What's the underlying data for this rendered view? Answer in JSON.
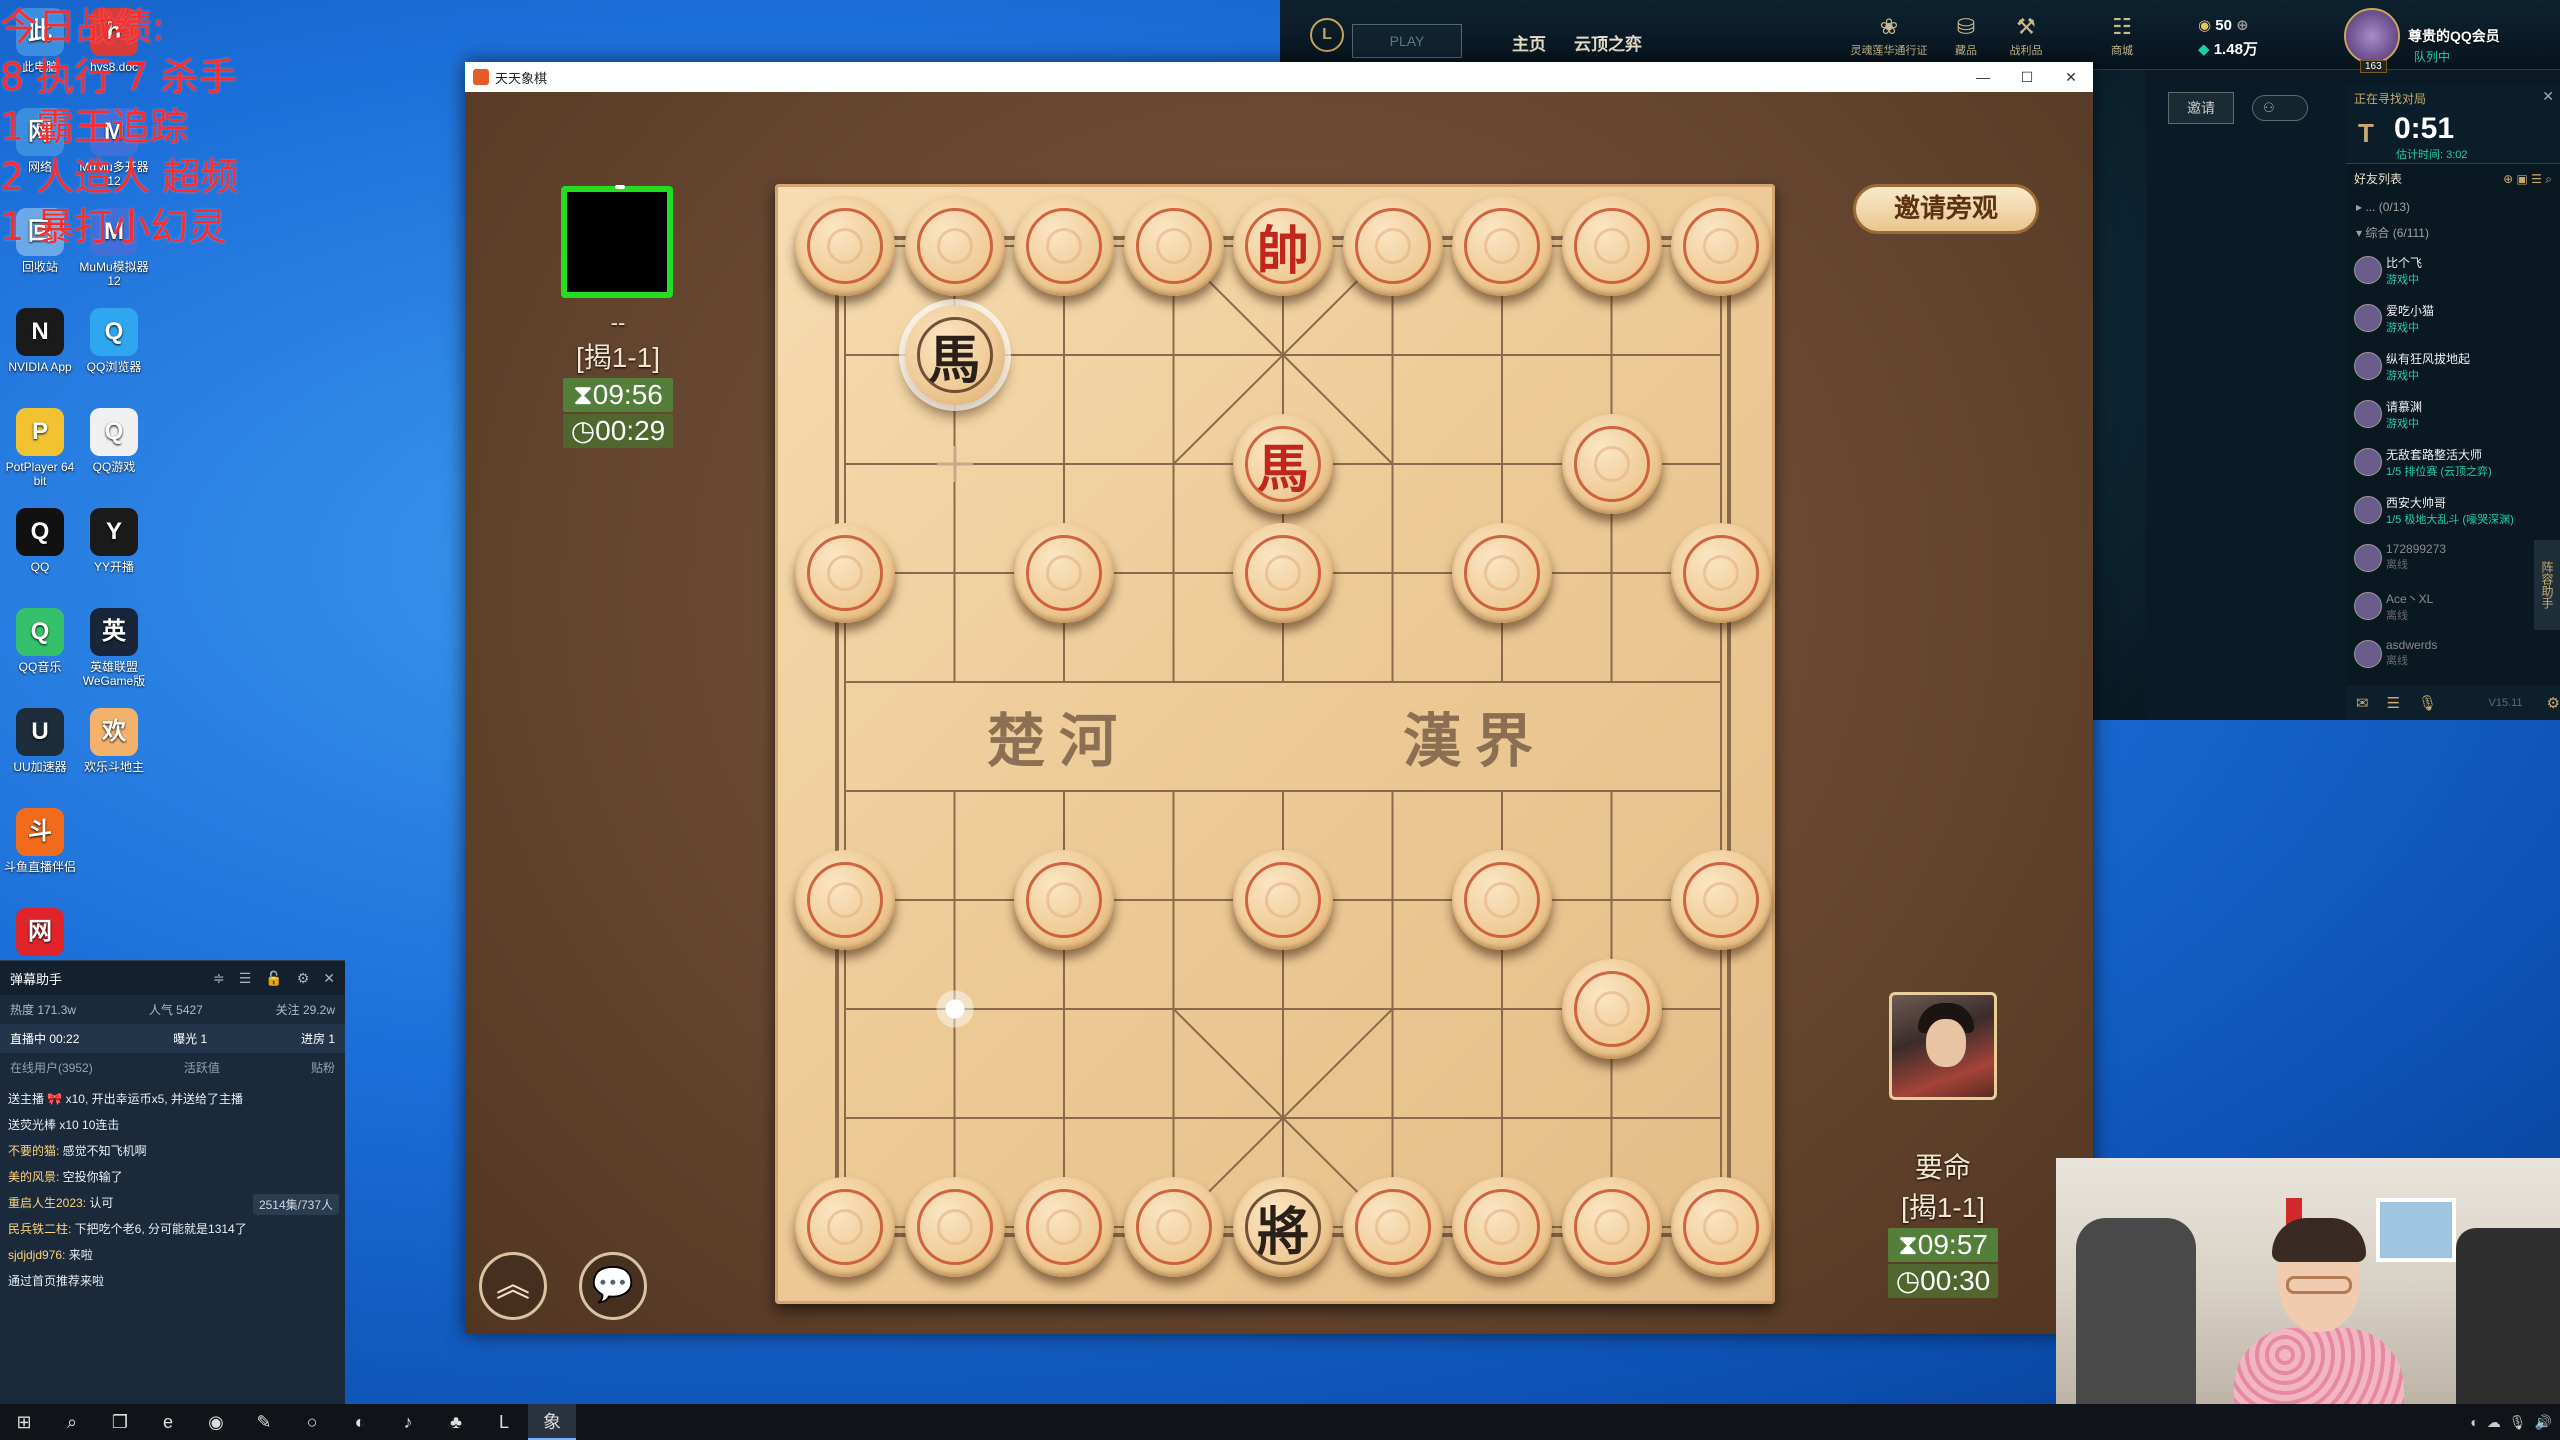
{
  "desktop": {
    "overlay_lines": [
      "今日战绩:",
      "8 执行 7 杀手",
      "1 霸王追踪",
      "2 人造人 超频",
      "1 暴打小幻灵"
    ],
    "icons": [
      {
        "label": "此电脑",
        "icon": "computer-icon",
        "color": "#3b8de0"
      },
      {
        "label": "hys8.doc",
        "icon": "document-icon",
        "color": "#d93b3b"
      },
      {
        "label": "网络",
        "icon": "network-icon",
        "color": "#3b8de0"
      },
      {
        "label": "MuMu多开器12",
        "icon": "mumu-icon",
        "color": "#3f6fd8"
      },
      {
        "label": "回收站",
        "icon": "recycle-bin-icon",
        "color": "#6aa8e8"
      },
      {
        "label": "MuMu模拟器12",
        "icon": "mumu-icon",
        "color": "#3f6fd8"
      },
      {
        "label": "NVIDIA App",
        "icon": "nvidia-icon",
        "color": "#1a1a1a"
      },
      {
        "label": "QQ浏览器",
        "icon": "qq-browser-icon",
        "color": "#2fa6f0"
      },
      {
        "label": "PotPlayer 64 bit",
        "icon": "potplayer-icon",
        "color": "#f1c232"
      },
      {
        "label": "QQ游戏",
        "icon": "qq-game-icon",
        "color": "#f0f0f0"
      },
      {
        "label": "QQ",
        "icon": "qq-penguin-icon",
        "color": "#111111"
      },
      {
        "label": "YY开播",
        "icon": "yy-icon",
        "color": "#1a1a1a"
      },
      {
        "label": "QQ音乐",
        "icon": "qq-music-icon",
        "color": "#35c16b"
      },
      {
        "label": "英雄联盟WeGame版",
        "icon": "lol-icon",
        "color": "#18253a"
      },
      {
        "label": "UU加速器",
        "icon": "uu-icon",
        "color": "#1d2c3a"
      },
      {
        "label": "欢乐斗地主",
        "icon": "doudizhu-icon",
        "color": "#f2b26b"
      },
      {
        "label": "斗鱼直播伴侣",
        "icon": "douyu-icon",
        "color": "#f26b1d"
      },
      {
        "label": "网易云音乐",
        "icon": "netease-music-icon",
        "color": "#e0242a"
      }
    ]
  },
  "danmu": {
    "title": "弹幕助手",
    "stats": [
      "热度 171.3w",
      "人气 5427",
      "关注 29.2w"
    ],
    "live_time": "直播中 00:22",
    "exposure": "曝光 1",
    "progress": "进房 1",
    "online": "在线用户(3952)",
    "tabs": [
      "活跃值",
      "贴粉"
    ],
    "messages": [
      {
        "user": "",
        "text": "送主播 🎀 x10, 开出幸运币x5, 并送给了主播"
      },
      {
        "user": "",
        "text": "送荧光棒 x10 10连击"
      },
      {
        "user": "不要的猫",
        "text": "感觉不知飞机啊"
      },
      {
        "user": "美的风景",
        "text": "空投你输了"
      },
      {
        "user": "重启人生2023",
        "text": "认可"
      },
      {
        "user": "民兵铁二柱",
        "text": "下把吃个老6, 分可能就是1314了"
      },
      {
        "user": "sjdjdjd976",
        "text": "来啦"
      },
      {
        "user": "",
        "text": "通过首页推荐来啦"
      }
    ],
    "count": "2514集/737人"
  },
  "taskbar": {
    "apps": [
      {
        "name": "start-icon",
        "glyph": "⊞"
      },
      {
        "name": "search-icon",
        "glyph": "⌕"
      },
      {
        "name": "task-view-icon",
        "glyph": "❐"
      },
      {
        "name": "edge-icon",
        "glyph": "e"
      },
      {
        "name": "netease-icon",
        "glyph": "◉"
      },
      {
        "name": "mouse-icon",
        "glyph": "✎"
      },
      {
        "name": "yy-icon",
        "glyph": "○"
      },
      {
        "name": "qq-browser-icon",
        "glyph": "◐"
      },
      {
        "name": "qq-music-icon",
        "glyph": "♪"
      },
      {
        "name": "doudizhu-icon",
        "glyph": "♣"
      },
      {
        "name": "lol-icon",
        "glyph": "L"
      },
      {
        "name": "xiangqi-icon",
        "glyph": "象"
      }
    ]
  },
  "lol": {
    "play_label": "PLAY",
    "nav": [
      "主页",
      "云顶之弈"
    ],
    "top_icons": [
      {
        "label": "灵魂莲华通行证",
        "icon": "lotus-icon"
      },
      {
        "label": "藏品",
        "icon": "collection-icon"
      },
      {
        "label": "战利品",
        "icon": "loot-icon"
      },
      {
        "label": "商城",
        "icon": "store-icon"
      }
    ],
    "currency": {
      "rp": "50",
      "be": "1.48万"
    },
    "profile": {
      "name": "尊贵的QQ会员",
      "status": "队列中",
      "level": "163"
    },
    "invite_label": "邀请",
    "queue": {
      "title": "正在寻找对局",
      "timer": "0:51",
      "estimate": "估计时间: 3:02"
    },
    "friends_title": "好友列表",
    "groups": [
      "... (0/13)",
      "综合 (6/111)"
    ],
    "friends": [
      {
        "name": "比个飞",
        "status": "游戏中",
        "online": true
      },
      {
        "name": "爱吃小猫",
        "status": "游戏中",
        "online": true
      },
      {
        "name": "纵有狂风拔地起",
        "status": "游戏中",
        "online": true
      },
      {
        "name": "请慕渊",
        "status": "游戏中",
        "online": true
      },
      {
        "name": "无敌套路整活大师",
        "status": "1/5 排位赛 (云顶之弈)",
        "online": true
      },
      {
        "name": "西安大帅哥",
        "status": "1/5 极地大乱斗 (嚎哭深渊)",
        "online": true
      },
      {
        "name": "172899273",
        "status": "离线",
        "online": false
      },
      {
        "name": "Ace丶XL",
        "status": "离线",
        "online": false
      },
      {
        "name": "asdwerds",
        "status": "离线",
        "online": false
      }
    ],
    "version": "V15.11",
    "side_tab": "阵容助手"
  },
  "chess": {
    "window_title": "天天象棋",
    "opponent": {
      "name": "--",
      "rank": "[揭1-1]",
      "total_time": "09:56",
      "move_time": "00:29"
    },
    "self": {
      "name": "要命",
      "rank": "[揭1-1]",
      "total_time": "09:57",
      "move_time": "00:30"
    },
    "invite_audience": "邀请旁观",
    "river_left": "楚河",
    "river_right": "漢界",
    "pieces": [
      {
        "col": 0,
        "row": 0,
        "char": ""
      },
      {
        "col": 1,
        "row": 0,
        "char": ""
      },
      {
        "col": 2,
        "row": 0,
        "char": ""
      },
      {
        "col": 3,
        "row": 0,
        "char": ""
      },
      {
        "col": 4,
        "row": 0,
        "char": "帥",
        "side": "red"
      },
      {
        "col": 5,
        "row": 0,
        "char": ""
      },
      {
        "col": 6,
        "row": 0,
        "char": ""
      },
      {
        "col": 7,
        "row": 0,
        "char": ""
      },
      {
        "col": 8,
        "row": 0,
        "char": ""
      },
      {
        "col": 1,
        "row": 1,
        "char": "馬",
        "side": "black",
        "selected": true
      },
      {
        "col": 4,
        "row": 2,
        "char": "馬",
        "side": "red"
      },
      {
        "col": 7,
        "row": 2,
        "char": ""
      },
      {
        "col": 0,
        "row": 3,
        "char": ""
      },
      {
        "col": 2,
        "row": 3,
        "char": ""
      },
      {
        "col": 4,
        "row": 3,
        "char": ""
      },
      {
        "col": 6,
        "row": 3,
        "char": ""
      },
      {
        "col": 8,
        "row": 3,
        "char": ""
      },
      {
        "col": 0,
        "row": 6,
        "char": ""
      },
      {
        "col": 2,
        "row": 6,
        "char": ""
      },
      {
        "col": 4,
        "row": 6,
        "char": ""
      },
      {
        "col": 6,
        "row": 6,
        "char": ""
      },
      {
        "col": 8,
        "row": 6,
        "char": ""
      },
      {
        "col": 7,
        "row": 7,
        "char": ""
      },
      {
        "col": 0,
        "row": 9,
        "char": ""
      },
      {
        "col": 1,
        "row": 9,
        "char": ""
      },
      {
        "col": 2,
        "row": 9,
        "char": ""
      },
      {
        "col": 3,
        "row": 9,
        "char": ""
      },
      {
        "col": 4,
        "row": 9,
        "char": "將",
        "side": "black"
      },
      {
        "col": 5,
        "row": 9,
        "char": ""
      },
      {
        "col": 6,
        "row": 9,
        "char": ""
      },
      {
        "col": 7,
        "row": 9,
        "char": ""
      },
      {
        "col": 8,
        "row": 9,
        "char": ""
      }
    ],
    "last_move_from": {
      "col": 1,
      "row": 2
    },
    "hint_dot": {
      "col": 1,
      "row": 7
    }
  }
}
